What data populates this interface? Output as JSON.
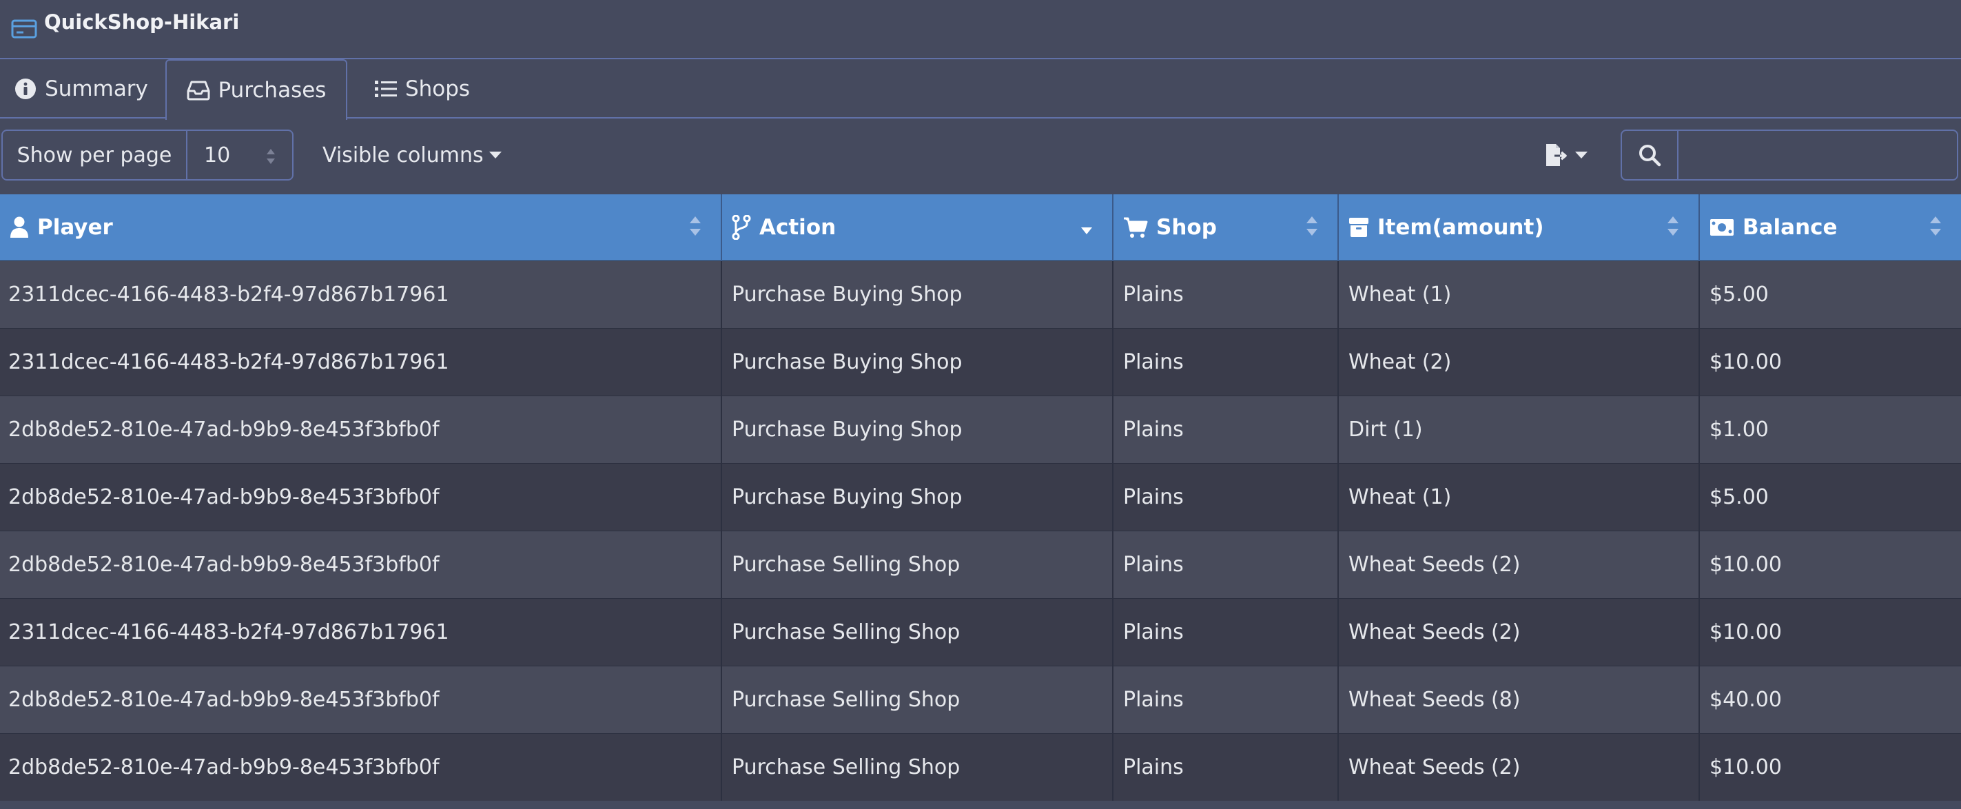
{
  "app": {
    "title": "QuickShop-Hikari"
  },
  "tabs": [
    {
      "label": "Summary",
      "icon": "info-circle-icon"
    },
    {
      "label": "Purchases",
      "icon": "inbox-tray-icon"
    },
    {
      "label": "Shops",
      "icon": "list-icon"
    }
  ],
  "active_tab": "Purchases",
  "toolbar": {
    "per_page_label": "Show per page",
    "per_page_value": "10",
    "visible_columns_label": "Visible columns",
    "search_value": ""
  },
  "table": {
    "columns": [
      {
        "label": "Player",
        "icon": "user-icon"
      },
      {
        "label": "Action",
        "icon": "code-branch-icon"
      },
      {
        "label": "Shop",
        "icon": "cart-icon"
      },
      {
        "label": "Item(amount)",
        "icon": "box-icon"
      },
      {
        "label": "Balance",
        "icon": "money-bill-icon"
      }
    ],
    "rows": [
      [
        "2311dcec-4166-4483-b2f4-97d867b17961",
        "Purchase Buying Shop",
        "Plains",
        "Wheat (1)",
        "$5.00"
      ],
      [
        "2311dcec-4166-4483-b2f4-97d867b17961",
        "Purchase Buying Shop",
        "Plains",
        "Wheat (2)",
        "$10.00"
      ],
      [
        "2db8de52-810e-47ad-b9b9-8e453f3bfb0f",
        "Purchase Buying Shop",
        "Plains",
        "Dirt (1)",
        "$1.00"
      ],
      [
        "2db8de52-810e-47ad-b9b9-8e453f3bfb0f",
        "Purchase Buying Shop",
        "Plains",
        "Wheat (1)",
        "$5.00"
      ],
      [
        "2db8de52-810e-47ad-b9b9-8e453f3bfb0f",
        "Purchase Selling Shop",
        "Plains",
        "Wheat Seeds (2)",
        "$10.00"
      ],
      [
        "2311dcec-4166-4483-b2f4-97d867b17961",
        "Purchase Selling Shop",
        "Plains",
        "Wheat Seeds (2)",
        "$10.00"
      ],
      [
        "2db8de52-810e-47ad-b9b9-8e453f3bfb0f",
        "Purchase Selling Shop",
        "Plains",
        "Wheat Seeds (8)",
        "$40.00"
      ],
      [
        "2db8de52-810e-47ad-b9b9-8e453f3bfb0f",
        "Purchase Selling Shop",
        "Plains",
        "Wheat Seeds (2)",
        "$10.00"
      ]
    ]
  },
  "colors": {
    "background": "#454a5e",
    "header_accent": "#4f87c9",
    "border_accent": "#6171a8",
    "row_odd": "#484b5b",
    "row_even": "#3a3c4b"
  }
}
